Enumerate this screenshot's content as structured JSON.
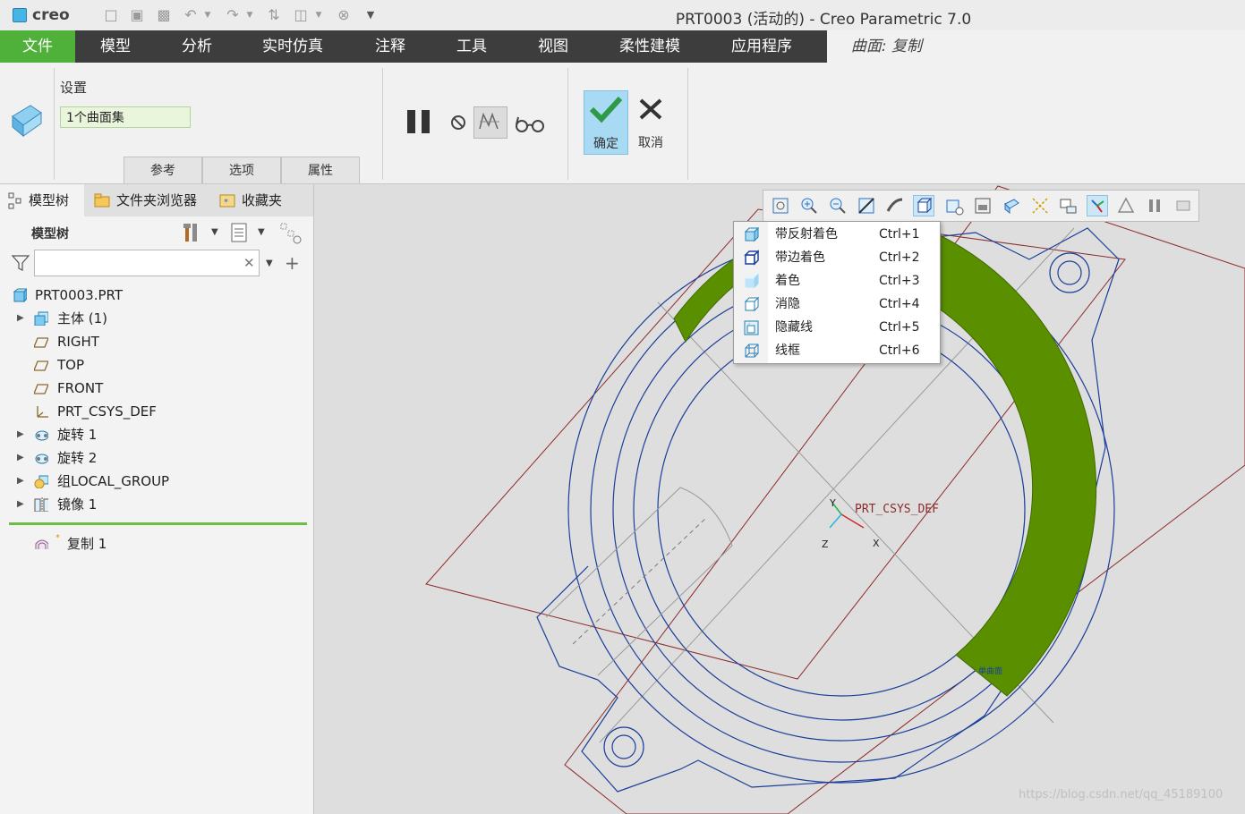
{
  "titlebar": {
    "app_logo": "creo",
    "window_title": "PRT0003 (活动的) - Creo Parametric 7.0"
  },
  "ribbon_tabs": {
    "file": "文件",
    "model": "模型",
    "analysis": "分析",
    "live_sim": "实时仿真",
    "annotate": "注释",
    "tools": "工具",
    "view": "视图",
    "flex_model": "柔性建模",
    "apps": "应用程序",
    "active": "曲面: 复制"
  },
  "ribbon": {
    "settings_label": "设置",
    "surface_set_value": "1个曲面集",
    "subtabs": [
      "参考",
      "选项",
      "属性"
    ],
    "ok_label": "确定",
    "cancel_label": "取消"
  },
  "left_panel": {
    "tabs": [
      "模型树",
      "文件夹浏览器",
      "收藏夹"
    ],
    "tree_title": "模型树",
    "search_placeholder": "",
    "items": [
      {
        "label": "PRT0003.PRT",
        "icon": "part-icon",
        "expandable": false
      },
      {
        "label": "主体 (1)",
        "icon": "body-icon",
        "expandable": true
      },
      {
        "label": "RIGHT",
        "icon": "datum-plane-icon",
        "expandable": false
      },
      {
        "label": "TOP",
        "icon": "datum-plane-icon",
        "expandable": false
      },
      {
        "label": "FRONT",
        "icon": "datum-plane-icon",
        "expandable": false
      },
      {
        "label": "PRT_CSYS_DEF",
        "icon": "csys-icon",
        "expandable": false
      },
      {
        "label": "旋转 1",
        "icon": "revolve-icon",
        "expandable": true
      },
      {
        "label": "旋转 2",
        "icon": "revolve-icon",
        "expandable": true
      },
      {
        "label": "组LOCAL_GROUP",
        "icon": "group-icon",
        "expandable": true
      },
      {
        "label": "镜像 1",
        "icon": "mirror-icon",
        "expandable": true
      }
    ],
    "new_item": {
      "label": "复制 1",
      "icon": "surface-copy-icon"
    }
  },
  "display_style_menu": {
    "items": [
      {
        "label": "带反射着色",
        "shortcut": "Ctrl+1"
      },
      {
        "label": "带边着色",
        "shortcut": "Ctrl+2"
      },
      {
        "label": "着色",
        "shortcut": "Ctrl+3"
      },
      {
        "label": "消隐",
        "shortcut": "Ctrl+4"
      },
      {
        "label": "隐藏线",
        "shortcut": "Ctrl+5"
      },
      {
        "label": "线框",
        "shortcut": "Ctrl+6"
      }
    ]
  },
  "viewport": {
    "csys_label": "PRT_CSYS_DEF",
    "axis_x": "X",
    "axis_y": "Y",
    "axis_z": "Z",
    "surface_tag": "单曲面"
  },
  "watermark": "https://blog.csdn.net/qq_45189100",
  "colors": {
    "accent_green": "#4fb03a",
    "tab_bar": "#3d3d3d",
    "surface_green": "#5a8f00",
    "edge_blue": "#1a3f9a",
    "datum_red": "#8e2a2a"
  }
}
